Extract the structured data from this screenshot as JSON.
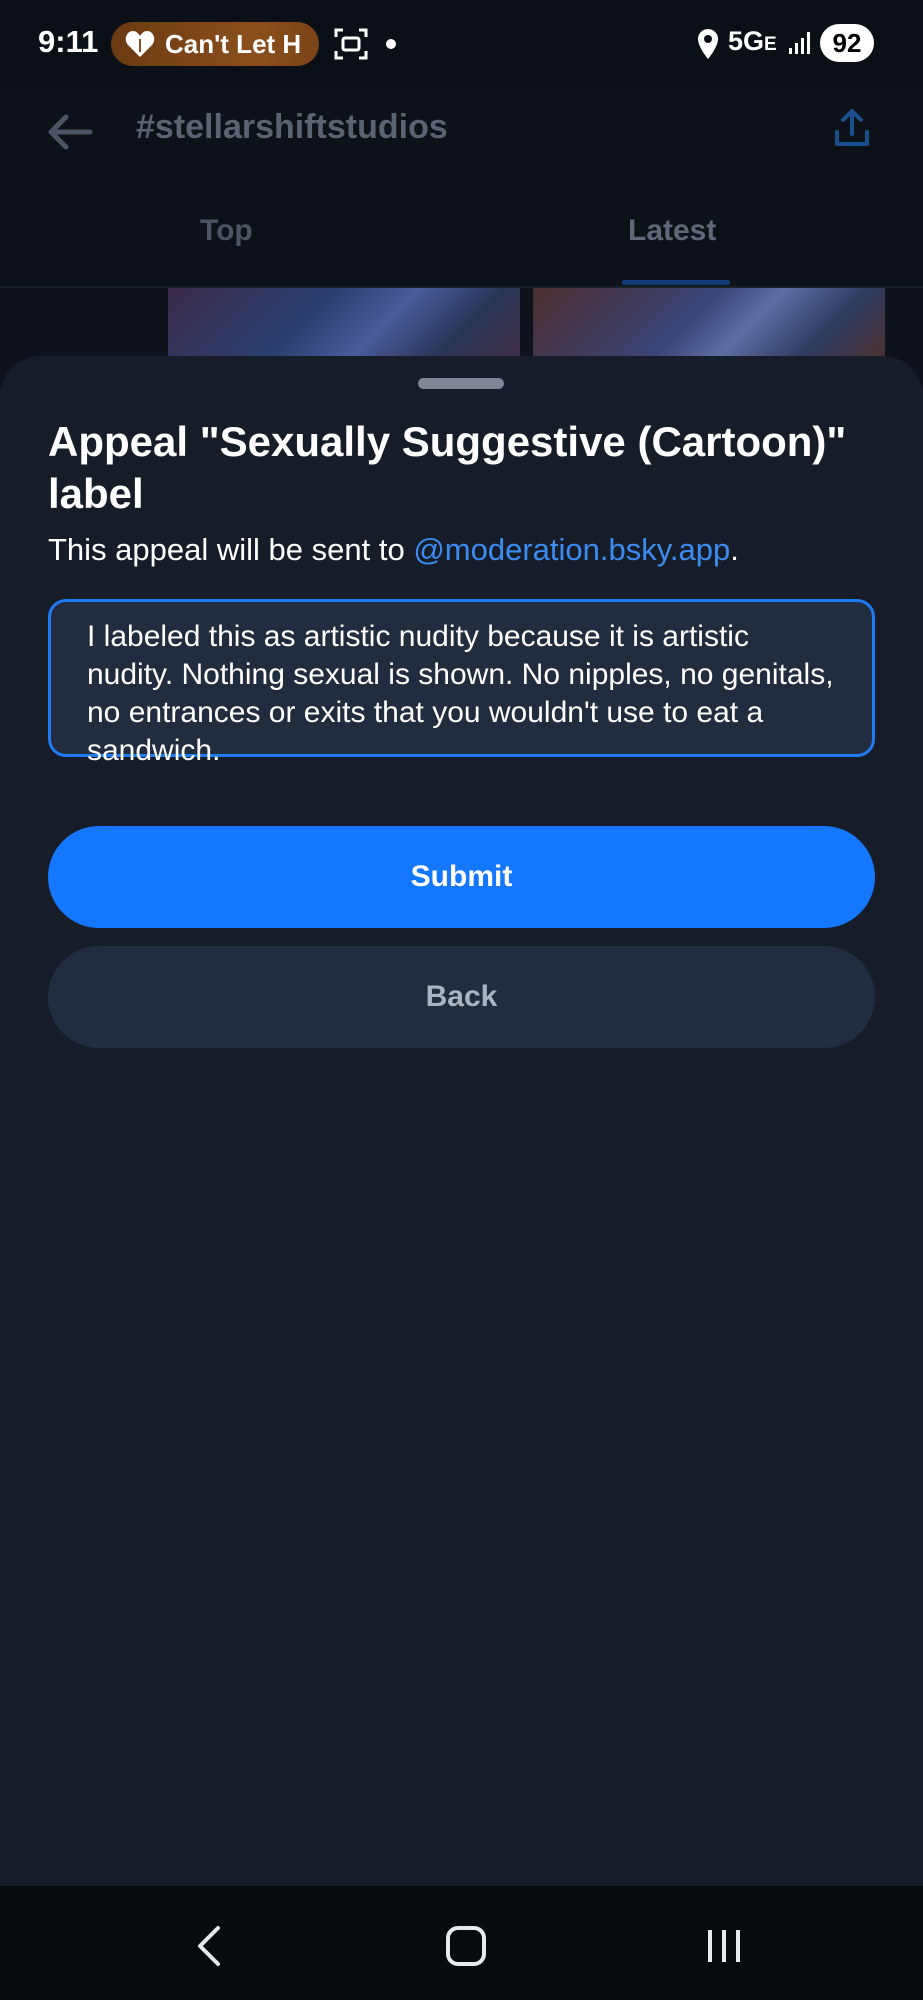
{
  "status_bar": {
    "time": "9:11",
    "notification_pill": "Can't Let H",
    "network": "5G",
    "network_suffix": "E",
    "battery": "92"
  },
  "background_page": {
    "title": "#stellarshiftstudios",
    "tabs": [
      {
        "label": "Top",
        "active": false
      },
      {
        "label": "Latest",
        "active": true
      }
    ]
  },
  "sheet": {
    "title": "Appeal \"Sexually Suggestive (Cartoon)\" label",
    "subtitle_prefix": "This appeal will be sent to ",
    "subtitle_link": "@moderation.bsky.app",
    "subtitle_suffix": ".",
    "appeal_text": "I labeled this as artistic nudity because it is artistic nudity. Nothing sexual is shown. No nipples, no genitals, no entrances or exits that you wouldn't use to eat a sandwich.",
    "submit_label": "Submit",
    "back_label": "Back"
  },
  "colors": {
    "accent": "#1477fe",
    "link": "#3a8cf0",
    "sheet_bg": "#161d28",
    "input_bg": "#212d3e"
  },
  "icons": [
    "heart-icon",
    "screenshot-icon",
    "location-icon",
    "signal-icon",
    "back-arrow-icon",
    "share-icon",
    "nav-back-icon",
    "nav-home-icon",
    "nav-recents-icon"
  ]
}
